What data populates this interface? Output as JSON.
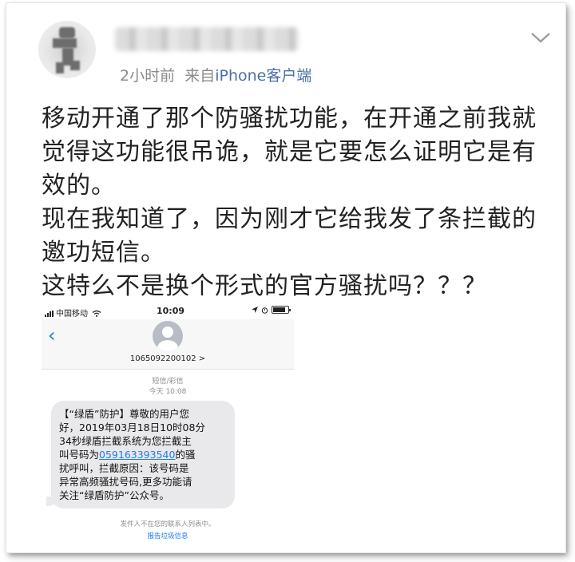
{
  "post": {
    "meta_time": "2小时前",
    "meta_from": "来自",
    "meta_source": "iPhone客户端",
    "text_lines": [
      "移动开通了那个防骚扰功能，在开通之前我就",
      "觉得这功能很吊诡，就是它要怎么证明它是有",
      "效的。",
      "现在我知道了，因为刚才它给我发了条拦截的",
      "邀功短信。",
      "这特么不是换个形式的官方骚扰吗？？？"
    ]
  },
  "phone": {
    "status": {
      "carrier": "中国移动",
      "time": "10:09"
    },
    "nav": {
      "back": "‹",
      "contact_number": "1065092200102 >"
    },
    "message_type": "短信/彩信",
    "message_time": "今天 10:08",
    "sms": {
      "line1": "【“绿盾”防护】尊敬的用户您",
      "line2": "好，2019年03月18日10时08分",
      "line3": "34秒绿盾拦截系统为您拦截主",
      "line4_before": "叫号码为",
      "line4_link": "059163393540",
      "line4_after": "的骚",
      "line5": "扰呼叫，拦截原因：该号码是",
      "line6": "异常高频骚扰号码,更多功能请",
      "line7": "关注“绿盾防护”公众号。"
    },
    "footer_note": "发件人不在您的联系人列表中。",
    "report_link": "报告垃圾信息"
  },
  "icons": {
    "chevron": "chevron-down-icon",
    "wifi": "wifi-icon",
    "location": "location-arrow-icon",
    "alarm": "alarm-icon",
    "battery": "battery-icon"
  },
  "colors": {
    "link": "#1f7bf6",
    "meta_source": "#4a6fa5",
    "bubble": "#e9e9eb"
  }
}
